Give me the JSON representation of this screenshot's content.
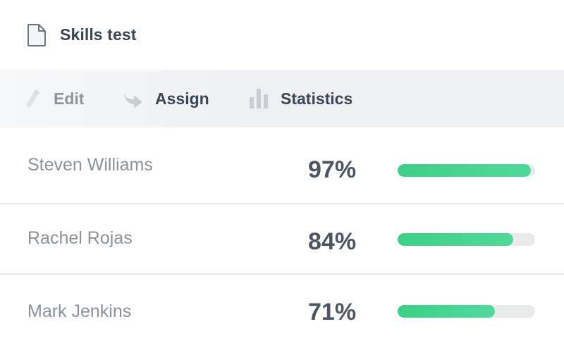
{
  "header": {
    "title": "Skills test",
    "icon": "document-icon"
  },
  "toolbar": {
    "edit_label": "Edit",
    "assign_label": "Assign",
    "statistics_label": "Statistics",
    "icons": [
      "pencil-icon",
      "forward-arrow-icon",
      "bar-chart-icon"
    ]
  },
  "results": [
    {
      "name": "Steven Williams",
      "score_text": "97%",
      "score": 0.97
    },
    {
      "name": "Rachel Rojas",
      "score_text": "84%",
      "score": 0.84
    },
    {
      "name": "Mark Jenkins",
      "score_text": "71%",
      "score": 0.71
    }
  ],
  "colors": {
    "accent_green": "#3ecf87",
    "track": "#e9eaec",
    "text_dark": "#3b4654",
    "text_muted": "#8a929c"
  }
}
